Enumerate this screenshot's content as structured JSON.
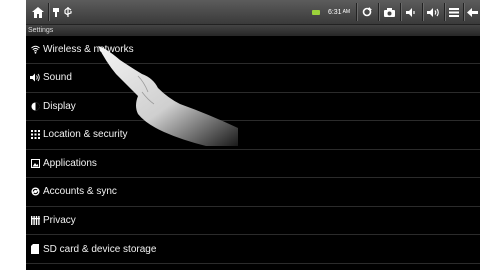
{
  "status_bar": {
    "clock": "6:31",
    "ampm": "AM",
    "icons": [
      "home-icon",
      "usb-icon",
      "usb-debug-icon",
      "battery-icon",
      "refresh-icon",
      "camera-icon",
      "volume-down-icon",
      "volume-up-icon",
      "menu-icon",
      "back-icon"
    ]
  },
  "title_bar": {
    "title": "Settings"
  },
  "settings": {
    "items": [
      {
        "label": "Wireless & networks",
        "icon": "wifi-icon"
      },
      {
        "label": "Sound",
        "icon": "speaker-icon"
      },
      {
        "label": "Display",
        "icon": "brightness-icon"
      },
      {
        "label": "Location & security",
        "icon": "grid-icon"
      },
      {
        "label": "Applications",
        "icon": "applications-icon"
      },
      {
        "label": "Accounts & sync",
        "icon": "sync-icon"
      },
      {
        "label": "Privacy",
        "icon": "privacy-icon"
      },
      {
        "label": "SD card & device storage",
        "icon": "sdcard-icon"
      }
    ]
  },
  "colors": {
    "background": "#000000",
    "status_bar": "#4a4a4a",
    "battery": "#9bd23b",
    "text": "#f2f2f2"
  }
}
